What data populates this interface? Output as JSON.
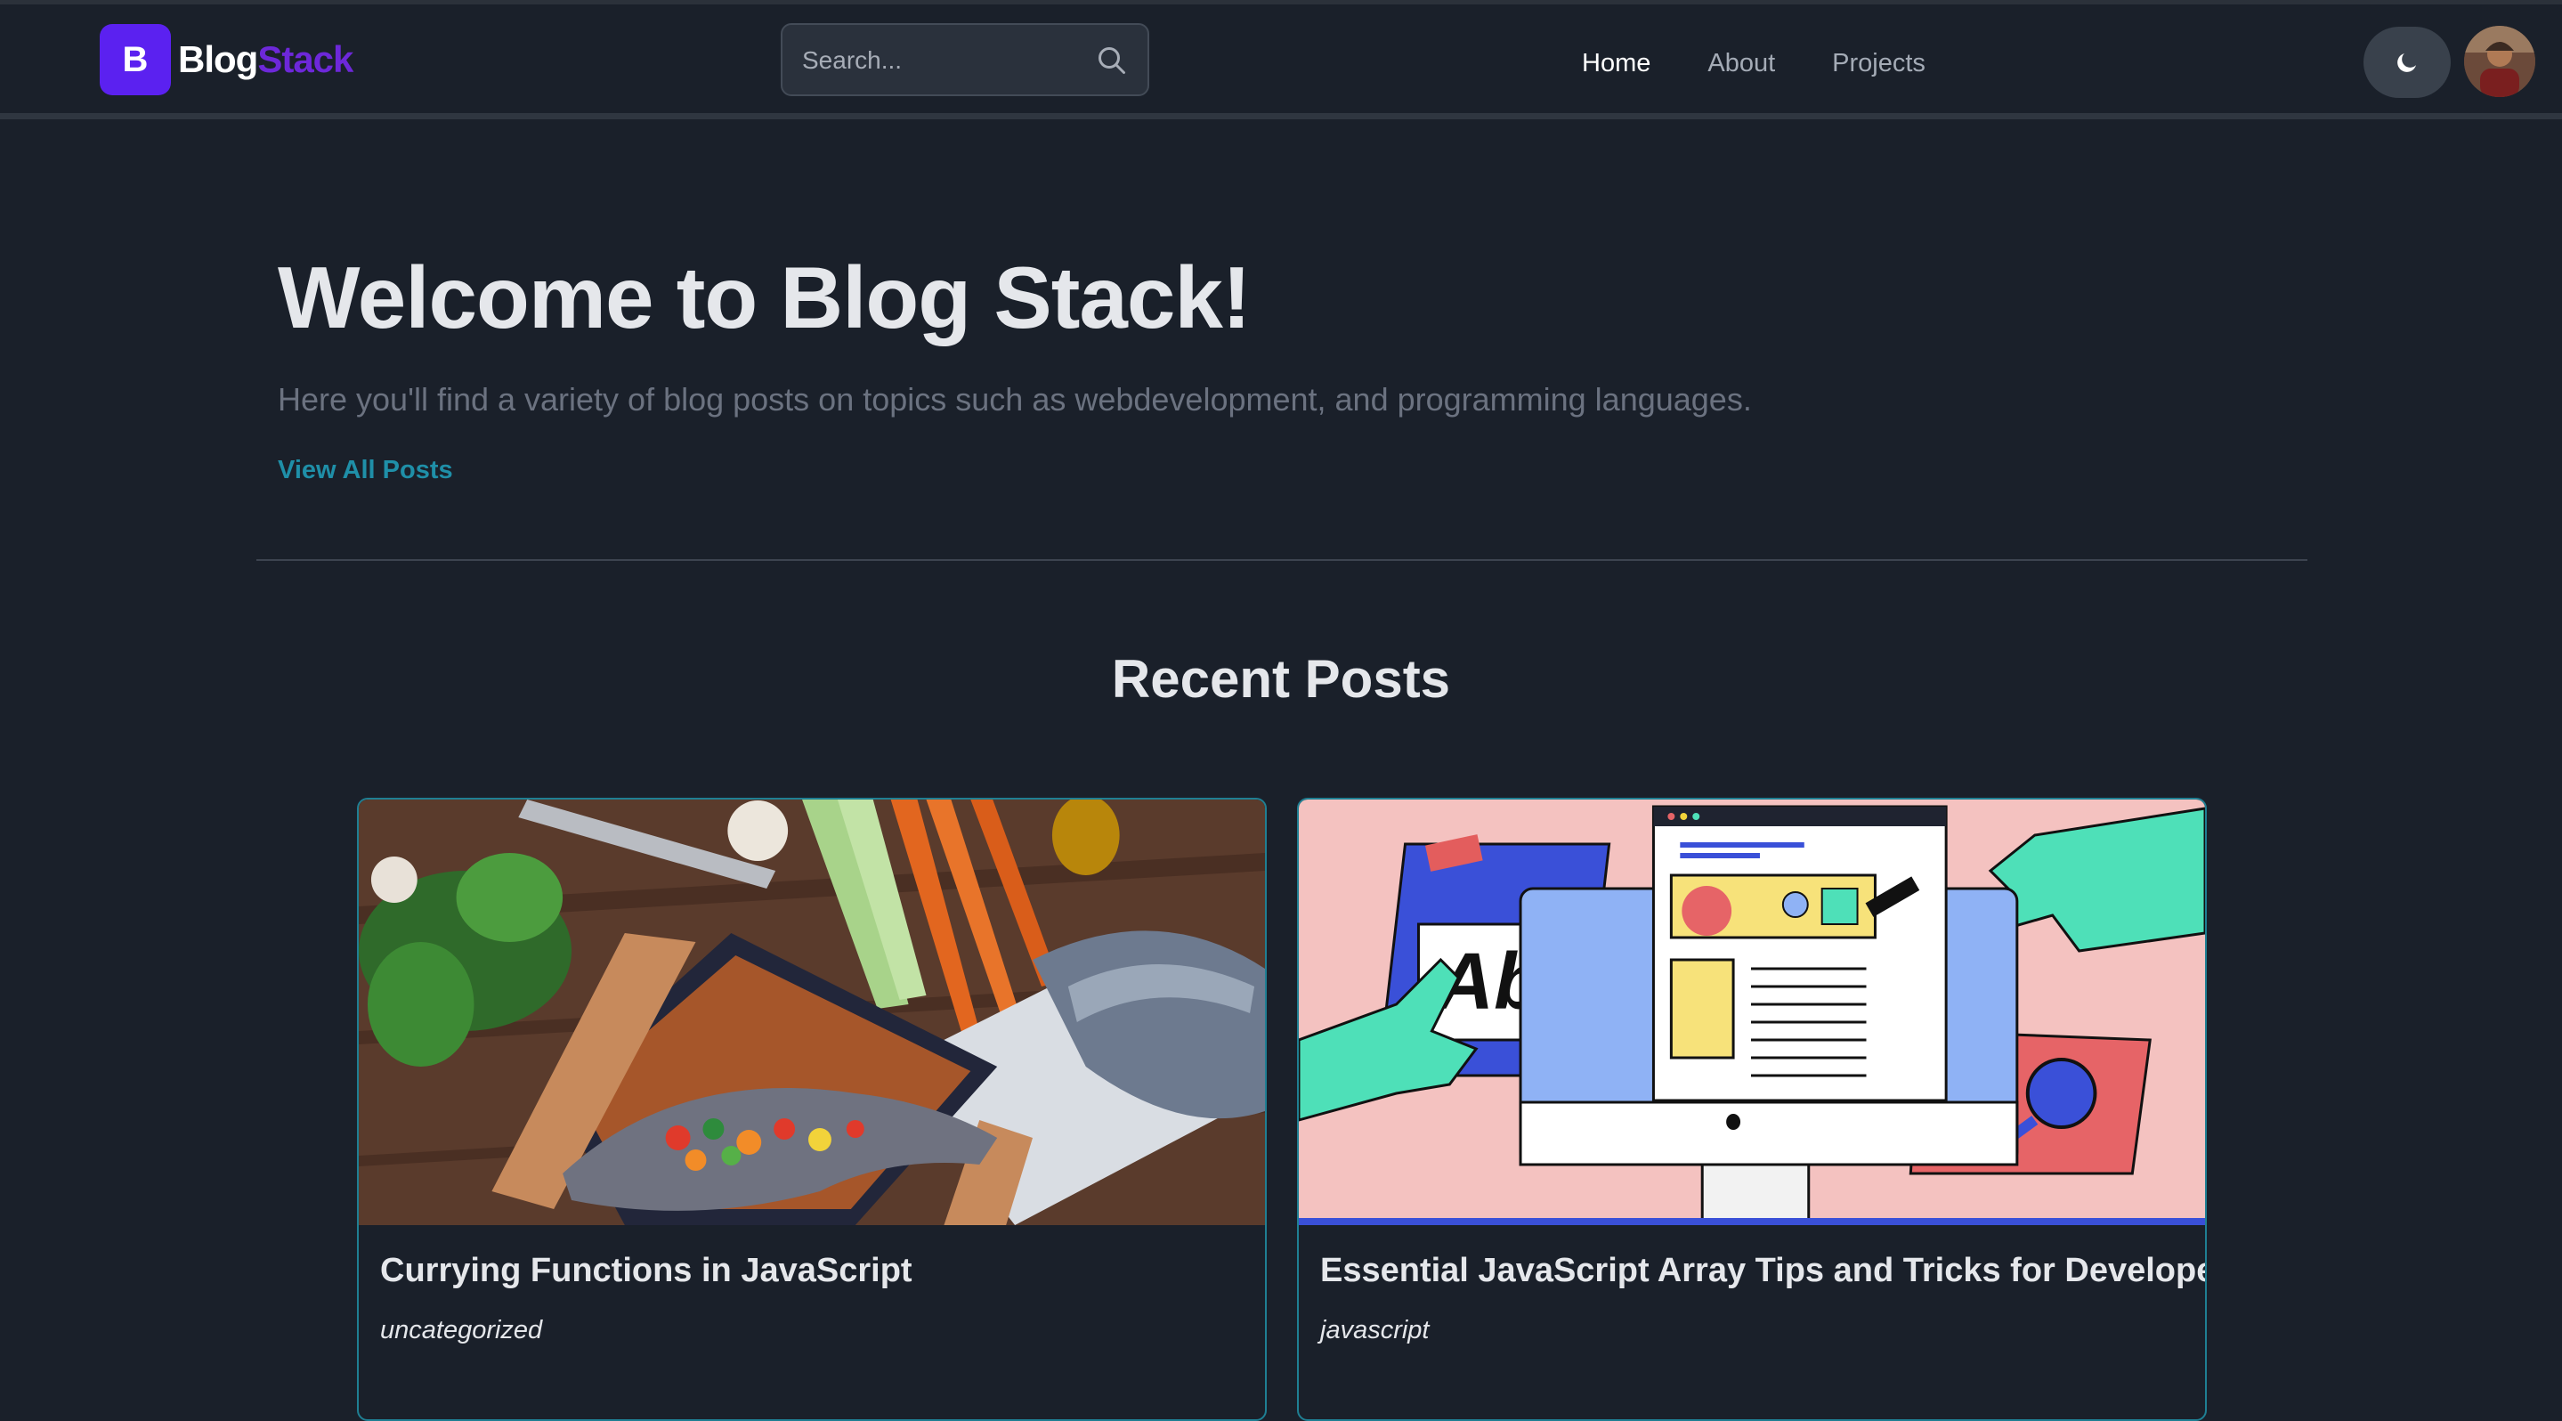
{
  "header": {
    "logo_letter": "B",
    "brand_part1": "Blog",
    "brand_part2": "Stack",
    "search_placeholder": "Search...",
    "nav": [
      {
        "label": "Home",
        "active": true
      },
      {
        "label": "About",
        "active": false
      },
      {
        "label": "Projects",
        "active": false
      }
    ],
    "theme_icon": "moon-icon",
    "avatar_icon": "user-avatar"
  },
  "hero": {
    "title": "Welcome to Blog Stack!",
    "subtitle": "Here you'll find a variety of blog posts on topics such as webdevelopment, and programming languages.",
    "cta": "View All Posts"
  },
  "recent": {
    "heading": "Recent Posts",
    "posts": [
      {
        "title": "Currying Functions in JavaScript",
        "category": "uncategorized",
        "image": "fish-vegetables-photo"
      },
      {
        "title": "Essential JavaScript Array Tips and Tricks for Developers",
        "category": "javascript",
        "image": "web-design-illustration"
      }
    ]
  },
  "colors": {
    "background": "#1a202a",
    "brand_accent": "#6d28d9",
    "logo_bg": "#5b21f0",
    "link": "#1f8fa8",
    "card_border": "#1f7f93"
  }
}
